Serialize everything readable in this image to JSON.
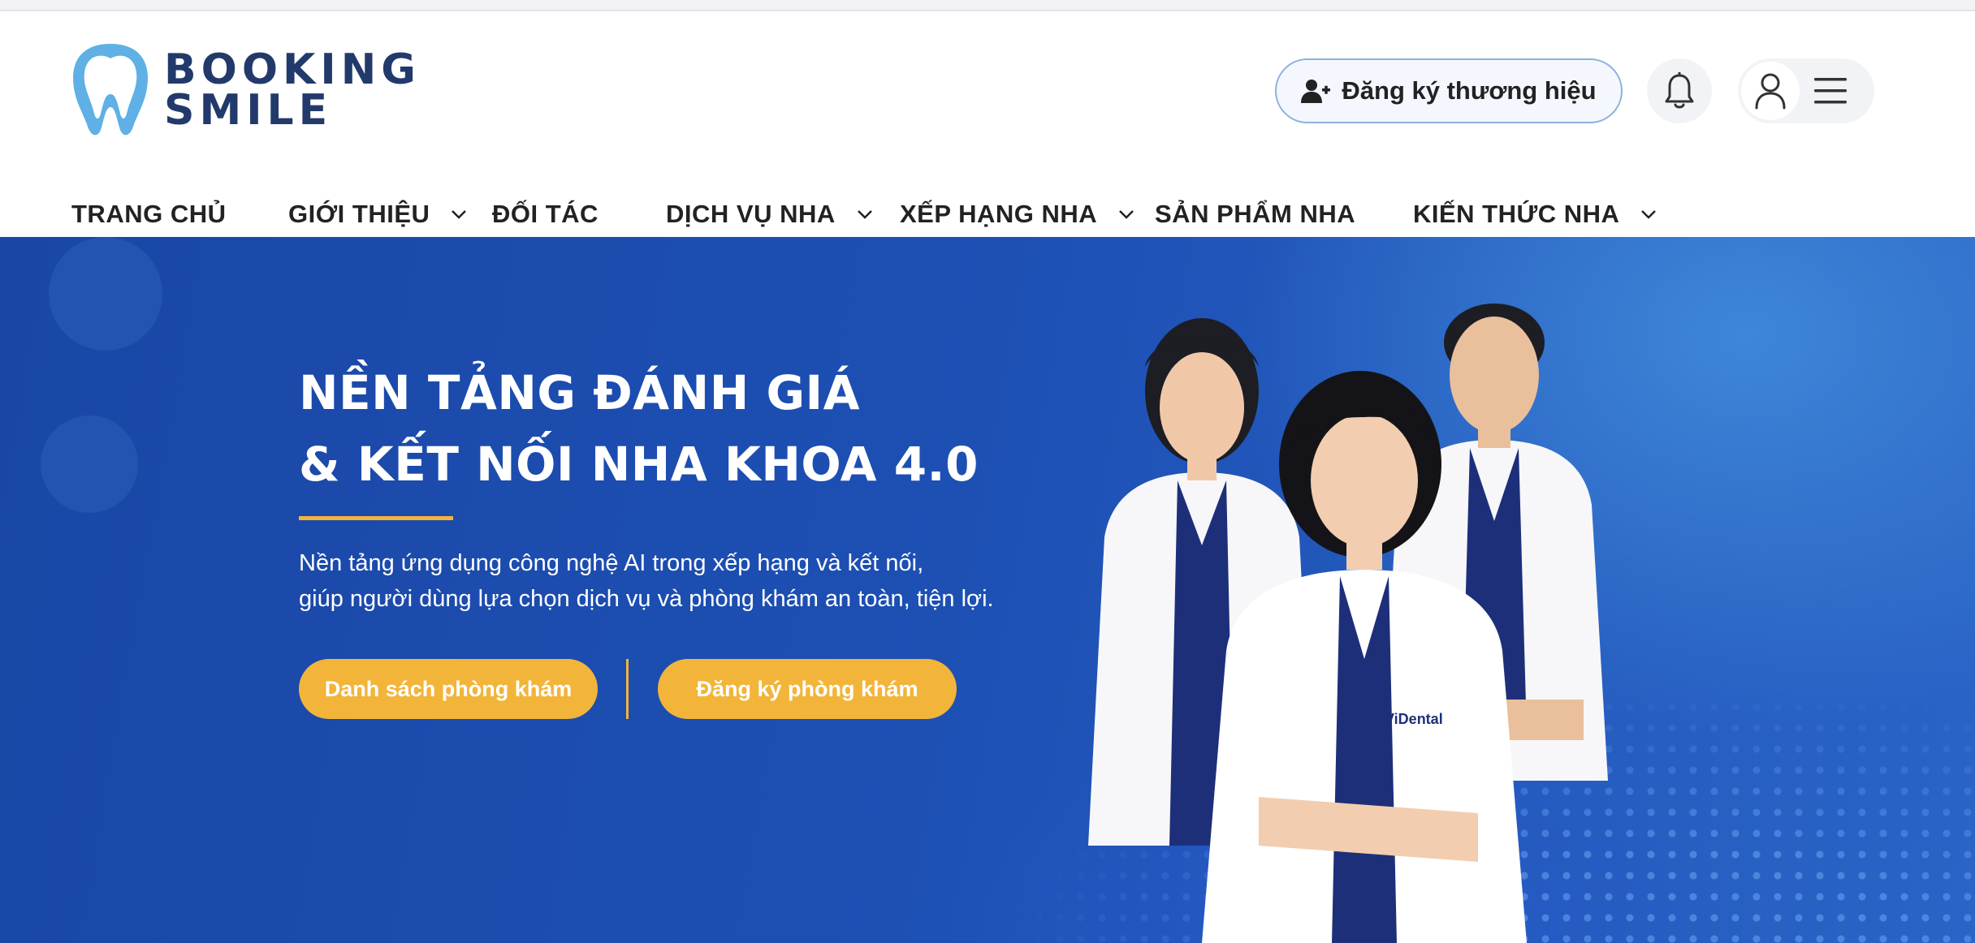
{
  "brand": {
    "line1": "BOOKING",
    "line2": "SMILE",
    "logo_icon": "tooth-icon",
    "color": "#223a6b",
    "accent": "#5fb0e5"
  },
  "header": {
    "register_brand_label": "Đăng ký thương hiệu",
    "register_icon": "user-plus-icon",
    "bell_icon": "bell-icon",
    "user_icon": "user-icon",
    "menu_icon": "hamburger-menu-icon"
  },
  "nav": {
    "items": [
      {
        "label": "TRANG CHỦ",
        "has_dropdown": false
      },
      {
        "label": "GIỚI THIỆU",
        "has_dropdown": true
      },
      {
        "label": "ĐỐI TÁC",
        "has_dropdown": false
      },
      {
        "label": "DỊCH VỤ NHA",
        "has_dropdown": true
      },
      {
        "label": "XẾP HẠNG NHA",
        "has_dropdown": true
      },
      {
        "label": "SẢN PHẨM NHA",
        "has_dropdown": false
      },
      {
        "label": "KIẾN THỨC NHA",
        "has_dropdown": true
      }
    ]
  },
  "hero": {
    "title_line1": "NỀN TẢNG ĐÁNH GIÁ",
    "title_line2": "& KẾT NỐI NHA KHOA 4.0",
    "desc_line1": "Nền tảng ứng dụng công nghệ AI trong xếp hạng và kết nối,",
    "desc_line2": "giúp người dùng lựa chọn dịch vụ và phòng khám an toàn, tiện lợi.",
    "button_clinic_list": "Danh sách phòng khám",
    "button_register_clinic": "Đăng ký phòng khám",
    "uniform_logo_text": "ViDental",
    "accent_color": "#f2b53a"
  }
}
